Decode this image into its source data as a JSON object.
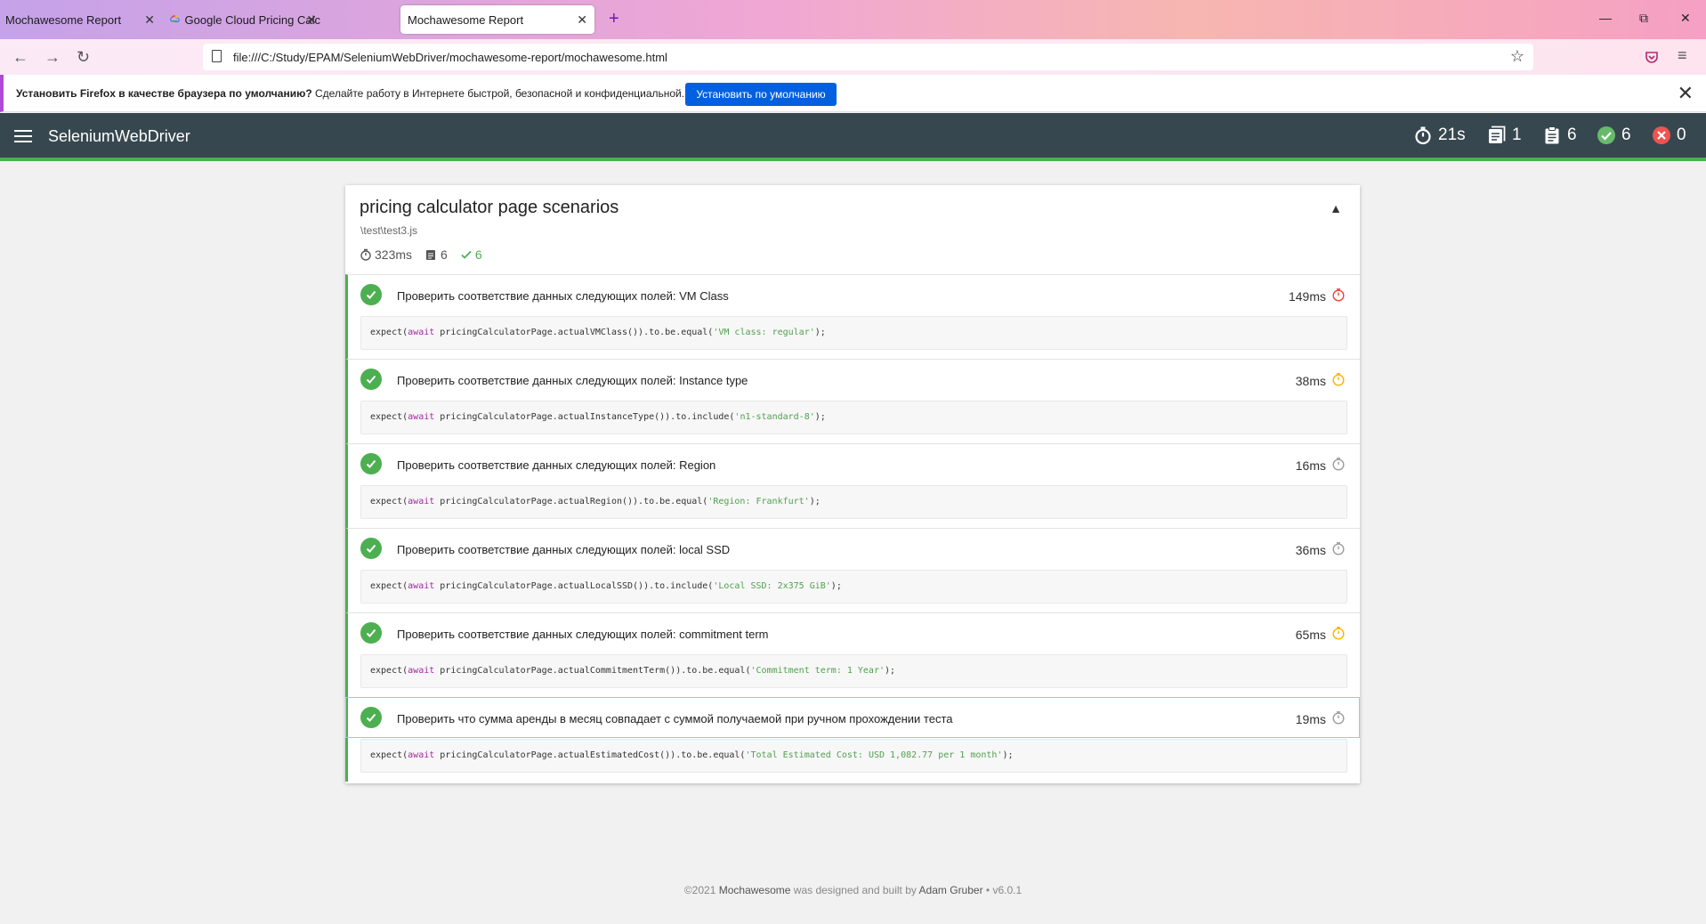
{
  "browser": {
    "tabs": [
      {
        "title": "Mochawesome Report",
        "active": false
      },
      {
        "title": "Google Cloud Pricing Calculator",
        "active": false
      },
      {
        "title": "Mochawesome Report",
        "active": true
      }
    ],
    "url": "file:///C:/Study/EPAM/SeleniumWebDriver/mochawesome-report/mochawesome.html",
    "notification": {
      "bold": "Установить Firefox в качестве браузера по умолчанию?",
      "text": "Сделайте работу в Интернете быстрой, безопасной и конфиденциальной.",
      "button": "Установить по умолчанию"
    }
  },
  "header": {
    "title": "SeleniumWebDriver",
    "duration": "21s",
    "suites": "1",
    "tests": "6",
    "passed": "6",
    "failed": "0"
  },
  "suite": {
    "title": "pricing calculator page scenarios",
    "file": "\\test\\test3.js",
    "duration": "323ms",
    "tests": "6",
    "passed": "6",
    "tests_list": [
      {
        "name": "Проверить соответствие данных следующих полей: VM Class",
        "duration": "149ms",
        "speed": "slow",
        "code": {
          "pre": "expect(",
          "kw": "await",
          "mid": " pricingCalculatorPage.actualVMClass()).to.be.equal(",
          "str": "'VM class: regular'",
          "post": ");"
        }
      },
      {
        "name": "Проверить соответствие данных следующих полей: Instance type",
        "duration": "38ms",
        "speed": "medium",
        "code": {
          "pre": "expect(",
          "kw": "await",
          "mid": " pricingCalculatorPage.actualInstanceType()).to.include(",
          "str": "'n1-standard-8'",
          "post": ");"
        }
      },
      {
        "name": "Проверить соответствие данных следующих полей: Region",
        "duration": "16ms",
        "speed": "fast",
        "code": {
          "pre": "expect(",
          "kw": "await",
          "mid": " pricingCalculatorPage.actualRegion()).to.be.equal(",
          "str": "'Region: Frankfurt'",
          "post": ");"
        }
      },
      {
        "name": "Проверить соответствие данных следующих полей: local SSD",
        "duration": "36ms",
        "speed": "fast",
        "code": {
          "pre": "expect(",
          "kw": "await",
          "mid": " pricingCalculatorPage.actualLocalSSD()).to.include(",
          "str": "'Local SSD: 2x375 GiB'",
          "post": ");"
        }
      },
      {
        "name": "Проверить соответствие данных следующих полей: commitment term",
        "duration": "65ms",
        "speed": "medium",
        "code": {
          "pre": "expect(",
          "kw": "await",
          "mid": " pricingCalculatorPage.actualCommitmentTerm()).to.be.equal(",
          "str": "'Commitment term: 1 Year'",
          "post": ");"
        }
      },
      {
        "name": "Проверить что сумма аренды в месяц совпадает с суммой получаемой при ручном прохождении теста",
        "duration": "19ms",
        "speed": "fast",
        "code": {
          "pre": "expect(",
          "kw": "await",
          "mid": " pricingCalculatorPage.actualEstimatedCost()).to.be.equal(",
          "str": "'Total Estimated Cost: USD 1,082.77 per 1 month'",
          "post": ");"
        }
      }
    ]
  },
  "footer": {
    "copyright": "©2021",
    "brand": "Mochawesome",
    "middle": "was designed and built by",
    "author": "Adam Gruber",
    "version": "• v6.0.1"
  },
  "colors": {
    "passed": "#4caf50",
    "failed": "#f44336",
    "slow": "#f44336",
    "medium": "#ffb300",
    "fast": "#9e9e9e",
    "header": "#37474f"
  }
}
